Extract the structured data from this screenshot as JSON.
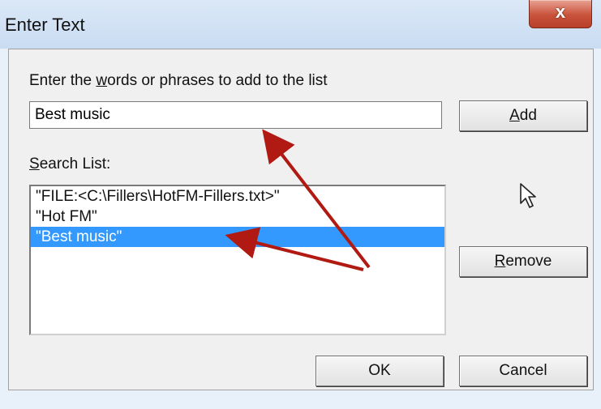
{
  "window": {
    "title": "Enter Text",
    "close_glyph": "x"
  },
  "prompt": {
    "before": "Enter the ",
    "mnemonic": "w",
    "after": "ords or phrases to add to the list"
  },
  "text_input": {
    "value": "Best music"
  },
  "search_list": {
    "label_mnemonic": "S",
    "label_rest": "earch List:",
    "items": [
      {
        "text": "\"FILE:<C:\\Fillers\\HotFM-Fillers.txt>\"",
        "selected": false
      },
      {
        "text": "\"Hot FM\"",
        "selected": false
      },
      {
        "text": "\"Best music\"",
        "selected": true
      }
    ]
  },
  "buttons": {
    "add": {
      "mnemonic": "A",
      "rest": "dd"
    },
    "remove": {
      "mnemonic": "R",
      "rest": "emove"
    },
    "ok": "OK",
    "cancel": "Cancel"
  },
  "icons": {
    "cursor": "mouse-pointer-icon",
    "annotation": "red-arrow"
  },
  "colors": {
    "selection": "#3399ff",
    "close": "#c9523a",
    "annotation_arrow": "#b01a12"
  }
}
